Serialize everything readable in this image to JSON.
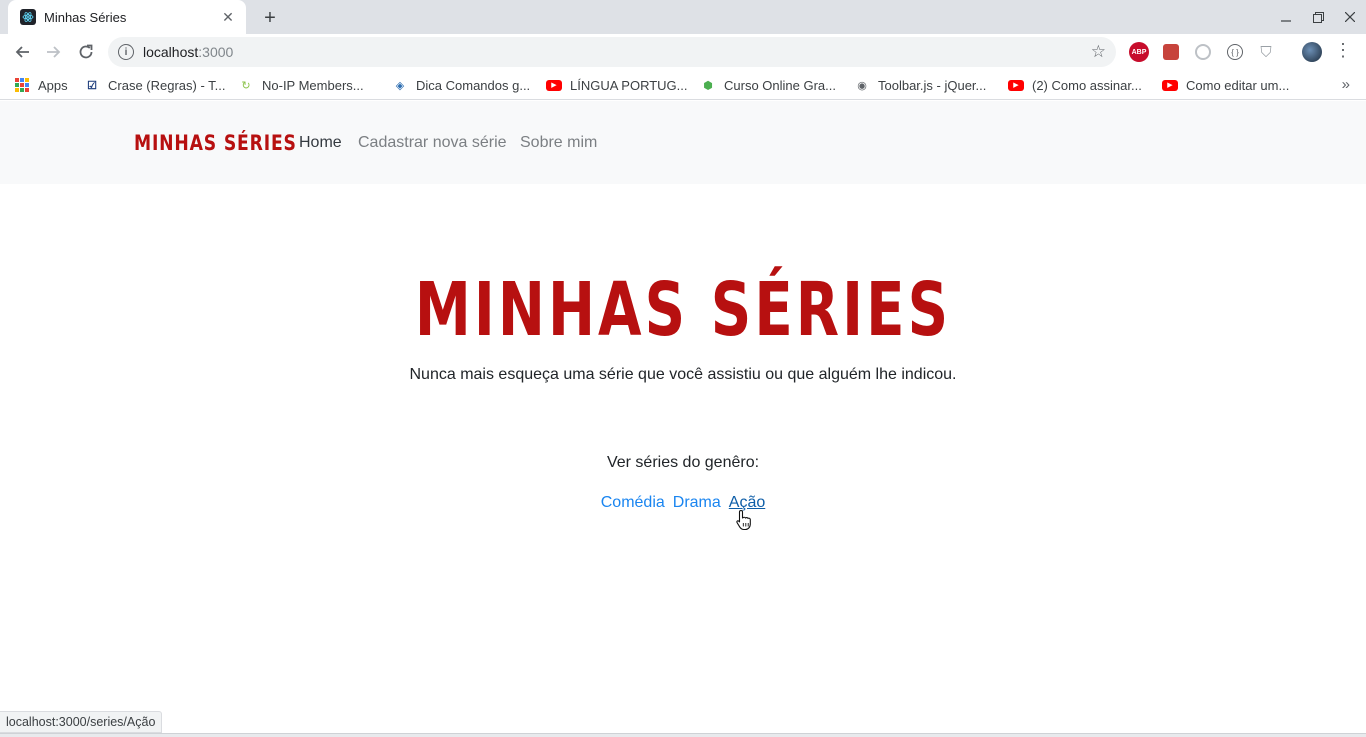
{
  "browser": {
    "tab_title": "Minhas Séries",
    "tab_close": "✕",
    "new_tab": "+",
    "url_host": "localhost",
    "url_port": ":3000",
    "bookmarks": [
      {
        "label": "Apps",
        "icon": "apps-grid-icon"
      },
      {
        "label": "Crase (Regras) - T...",
        "icon": "checkmark-icon"
      },
      {
        "label": "No-IP Members...",
        "icon": "no-ip-icon"
      },
      {
        "label": "Dica Comandos g...",
        "icon": "diamond-icon"
      },
      {
        "label": "LÍNGUA PORTUG...",
        "icon": "youtube-icon"
      },
      {
        "label": "Curso Online Gra...",
        "icon": "hexagon-icon"
      },
      {
        "label": "Toolbar.js - jQuer...",
        "icon": "globe-icon"
      },
      {
        "label": "(2) Como assinar...",
        "icon": "youtube-icon"
      },
      {
        "label": "Como editar um...",
        "icon": "youtube-icon"
      }
    ],
    "status_url": "localhost:3000/series/Ação"
  },
  "site": {
    "brand": "MINHAS SÉRIES",
    "nav": {
      "home": "Home",
      "register": "Cadastrar nova série",
      "about": "Sobre mim"
    },
    "hero_title": "MINHAS SÉRIES",
    "hero_subtitle": "Nunca mais esqueça uma série que você assistiu ou que alguém lhe indicou.",
    "genre_label": "Ver séries do genêro:",
    "genres": [
      "Comédia",
      "Drama",
      "Ação"
    ]
  },
  "colors": {
    "brand": "#b71010",
    "link": "#1a85f0",
    "nav_bg": "#f8f9fa"
  }
}
